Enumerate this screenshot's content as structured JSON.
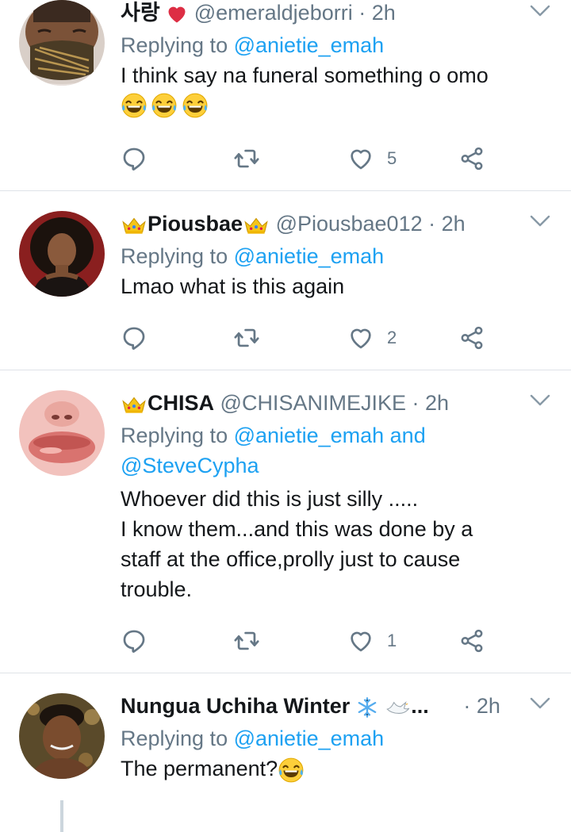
{
  "tweets": [
    {
      "display_name": "사랑",
      "name_emoji": "red-heart-emoji",
      "handle": "@emeraldjeborri",
      "time": "· 2h",
      "reply_prefix": "Replying to",
      "mentions": [
        "@anietie_emah"
      ],
      "text": "I think say na funeral something o omo",
      "trailing_emoji": [
        "laughing-tears-emoji",
        "laughing-tears-emoji",
        "laughing-tears-emoji"
      ],
      "likes": "5"
    },
    {
      "display_name": "Piousbae",
      "name_emoji": "crown-emoji",
      "handle": "@Piousbae012",
      "time": "· 2h",
      "reply_prefix": "Replying to",
      "mentions": [
        "@anietie_emah"
      ],
      "text": "Lmao what is this again",
      "likes": "2"
    },
    {
      "display_name": "CHISA",
      "name_emoji": "crown-emoji",
      "handle": "@CHISANIMEJIKE",
      "time": "· 2h",
      "reply_prefix": "Replying to",
      "mention_1": "@anietie_emah",
      "and": "and",
      "mention_2": "@SteveCypha",
      "text_lines": [
        "Whoever did this is just silly .....",
        "I know them...and this was done by a",
        "staff at the office,prolly just to cause",
        "trouble."
      ],
      "likes": "1"
    },
    {
      "display_name": "Nungua Uchiha Winter",
      "name_emoji": "snowflake-emoji, dove-emoji",
      "name_ellipsis": "...",
      "time": "· 2h",
      "reply_prefix": "Replying to",
      "mentions": [
        "@anietie_emah"
      ],
      "text": "The permanent?",
      "trailing_emoji": [
        "laughing-tears-emoji"
      ]
    }
  ],
  "icons": {
    "reply": "reply-icon",
    "retweet": "retweet-icon",
    "like": "heart-icon",
    "share": "share-icon",
    "menu": "chevron-down-icon"
  },
  "colors": {
    "link": "#1da1f2",
    "secondary": "#657786",
    "divider": "#dfe3e8"
  }
}
